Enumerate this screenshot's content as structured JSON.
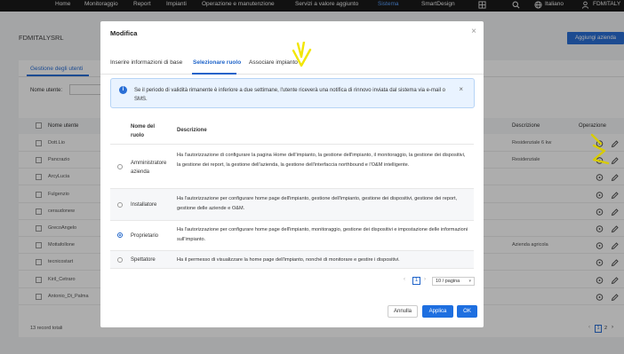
{
  "topnav": {
    "items": [
      "Home",
      "Monitoraggio",
      "Report",
      "Impianti",
      "Operazione e manutenzione",
      "Servizi a valore aggiunto",
      "Sistema"
    ],
    "smartdesign": "SmartDesign",
    "language": "Italiano",
    "user": "FDMITALY"
  },
  "background": {
    "company": "FDMITALYSRL",
    "add_company_button": "Aggiungi azienda",
    "tab": "Gestione degli utenti",
    "search_label": "Nome utente:",
    "columns": {
      "name": "Nome utente",
      "description": "Descrizione",
      "operation": "Operazione"
    },
    "rows": [
      {
        "name": "Dott.Lio",
        "description": "Residenziale 6 kw"
      },
      {
        "name": "Pancrazio",
        "description": "Residenziale"
      },
      {
        "name": "ArcyLucia",
        "description": ""
      },
      {
        "name": "Fulgenzio",
        "description": ""
      },
      {
        "name": "ceraudonew",
        "description": ""
      },
      {
        "name": "GrecoAngelo",
        "description": ""
      },
      {
        "name": "Mottafollone",
        "description": "Azienda agricola"
      },
      {
        "name": "tecnicostart",
        "description": ""
      },
      {
        "name": "Kiril_Cetraro",
        "description": ""
      },
      {
        "name": "Antonio_Di_Palma",
        "description": ""
      }
    ],
    "total": "13 record totali",
    "pager": {
      "page1": "1",
      "page2": "2"
    }
  },
  "modal": {
    "title": "Modifica",
    "tabs": [
      "Inserire informazioni di base",
      "Selezionare ruolo",
      "Associare impianto"
    ],
    "active_tab": 1,
    "notice": "Se il periodo di validità rimanente è inferiore a due settimane, l'utente riceverà una notifica di rinnovo inviata dal sistema via e-mail o SMS.",
    "table": {
      "col_role": "Nome del ruolo",
      "col_desc": "Descrizione",
      "rows": [
        {
          "role": "Amministratore azienda",
          "selected": false,
          "desc": "Ha l'autorizzazione di configurare la pagina Home dell'impianto, la gestione dell'impianto, il monitoraggio, la gestione dei dispositivi, la gestione dei report, la gestione dell'azienda, la gestione dell'interfaccia northbound e l'O&M intelligente."
        },
        {
          "role": "Installatore",
          "selected": false,
          "desc": "Ha l'autorizzazione per configurare home page dell'impianto, gestione dell'impianto, gestione dei dispositivi, gestione dei report, gestione delle aziende e O&M."
        },
        {
          "role": "Proprietario",
          "selected": true,
          "desc": "Ha l'autorizzazione per configurare home page dell'impianto, monitoraggio, gestione dei dispositivi e impostazione delle informazioni sull'impianto."
        },
        {
          "role": "Spettatore",
          "selected": false,
          "desc": "Ha il permesso di visualizzare la home page dell'impianto, nonché di monitorare e gestire i dispositivi."
        }
      ]
    },
    "pagination": {
      "current": "1",
      "page_size": "10 / pagina"
    },
    "buttons": {
      "cancel": "Annulla",
      "apply": "Applica",
      "ok": "OK"
    }
  },
  "colors": {
    "primary": "#1e6fe0",
    "nav": "#1a1a1a",
    "annotation": "#f2e600"
  }
}
